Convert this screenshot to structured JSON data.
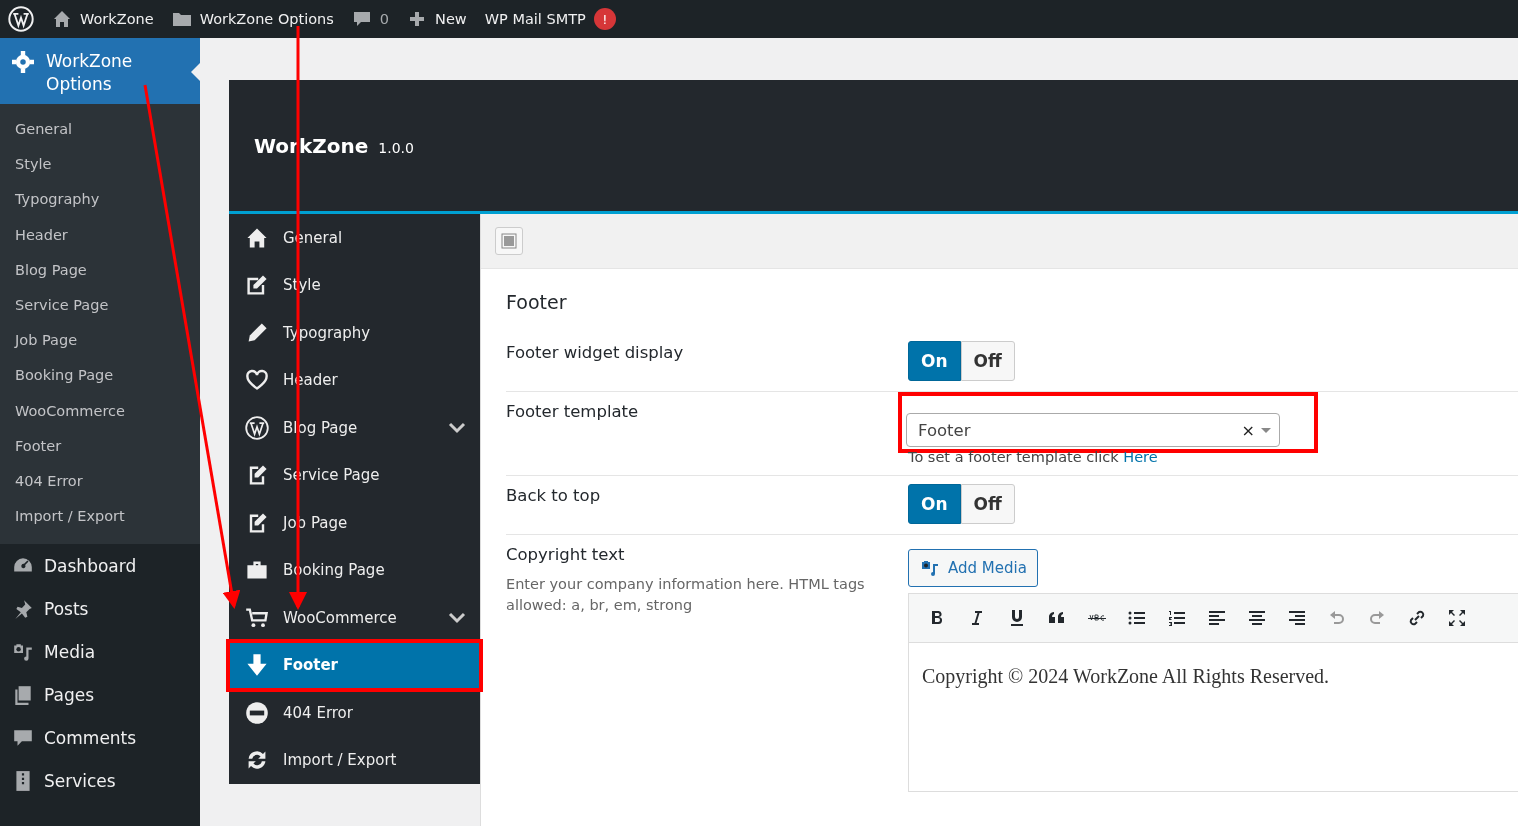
{
  "admin_bar": {
    "items": [
      {
        "kind": "logo"
      },
      {
        "kind": "home",
        "label": "WorkZone"
      },
      {
        "kind": "folder",
        "label": "WorkZone Options"
      },
      {
        "kind": "comments",
        "label": "0"
      },
      {
        "kind": "new",
        "label": "New"
      },
      {
        "kind": "plugin",
        "label": "WP Mail SMTP",
        "badge": "!"
      }
    ]
  },
  "sidebar": {
    "current": {
      "label": "WorkZone Options"
    },
    "submenu": [
      "General",
      "Style",
      "Typography",
      "Header",
      "Blog Page",
      "Service Page",
      "Job Page",
      "Booking Page",
      "WooCommerce",
      "Footer",
      "404 Error",
      "Import / Export"
    ],
    "menu": [
      {
        "label": "Dashboard"
      },
      {
        "label": "Posts"
      },
      {
        "label": "Media"
      },
      {
        "label": "Pages"
      },
      {
        "label": "Comments"
      },
      {
        "label": "Services"
      }
    ]
  },
  "panel": {
    "title": "WorkZone",
    "version": "1.0.0",
    "nav": [
      {
        "label": "General",
        "selected": false,
        "expandable": false,
        "highlighted": false
      },
      {
        "label": "Style",
        "selected": false,
        "expandable": false,
        "highlighted": false
      },
      {
        "label": "Typography",
        "selected": false,
        "expandable": false,
        "highlighted": false
      },
      {
        "label": "Header",
        "selected": false,
        "expandable": false,
        "highlighted": false
      },
      {
        "label": "Blog Page",
        "selected": false,
        "expandable": true,
        "highlighted": false
      },
      {
        "label": "Service Page",
        "selected": false,
        "expandable": false,
        "highlighted": false
      },
      {
        "label": "Job Page",
        "selected": false,
        "expandable": false,
        "highlighted": false
      },
      {
        "label": "Booking Page",
        "selected": false,
        "expandable": false,
        "highlighted": false
      },
      {
        "label": "WooCommerce",
        "selected": false,
        "expandable": true,
        "highlighted": false
      },
      {
        "label": "Footer",
        "selected": true,
        "expandable": false,
        "highlighted": true
      },
      {
        "label": "404 Error",
        "selected": false,
        "expandable": false,
        "highlighted": false
      },
      {
        "label": "Import / Export",
        "selected": false,
        "expandable": false,
        "highlighted": false
      }
    ],
    "section_title": "Footer",
    "fields": [
      {
        "kind": "toggle",
        "label": "Footer widget display",
        "options": [
          {
            "label": "On",
            "selected": true
          },
          {
            "label": "Off",
            "selected": false
          }
        ]
      },
      {
        "kind": "select",
        "label": "Footer template",
        "value": "Footer",
        "clear": "×",
        "highlighted": true,
        "help": "To set a footer template click ",
        "link": "Here"
      },
      {
        "kind": "toggle",
        "label": "Back to top",
        "options": [
          {
            "label": "On",
            "selected": true
          },
          {
            "label": "Off",
            "selected": false
          }
        ]
      },
      {
        "kind": "editor",
        "label": "Copyright text",
        "description": "Enter your company information here. HTML tags allowed: a, br, em, strong",
        "add_media": "Add Media",
        "content": "Copyright © 2024 WorkZone All Rights Reserved."
      }
    ]
  }
}
